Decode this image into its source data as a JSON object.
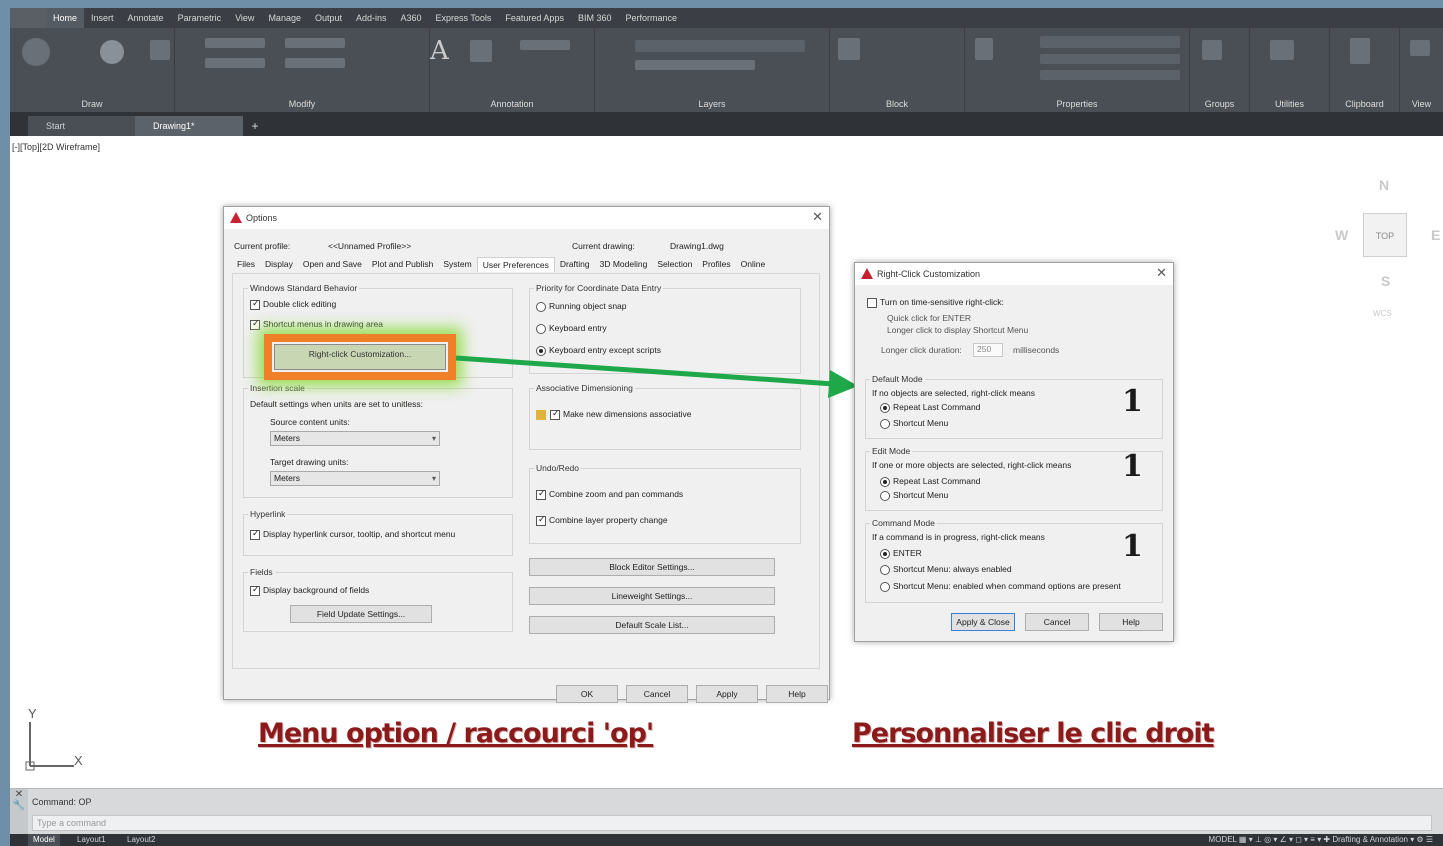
{
  "ribbon": {
    "tabs": [
      "Home",
      "Insert",
      "Annotate",
      "Parametric",
      "View",
      "Manage",
      "Output",
      "Add-ins",
      "A360",
      "Express Tools",
      "Featured Apps",
      "BIM 360",
      "Performance"
    ],
    "panels": [
      "Draw",
      "Modify",
      "Annotation",
      "Layers",
      "Block",
      "Properties",
      "Groups",
      "Utilities",
      "Clipboard",
      "View"
    ]
  },
  "file_tabs": {
    "start": "Start",
    "drawing": "Drawing1*",
    "plus": "+"
  },
  "viewport_label": "[-][Top][2D Wireframe]",
  "viewcube": {
    "top": "TOP",
    "n": "N",
    "w": "W",
    "e": "E",
    "s": "S",
    "wcs": "WCS"
  },
  "options_dialog": {
    "title": "Options",
    "current_profile_label": "Current profile:",
    "current_profile_value": "<<Unnamed Profile>>",
    "current_drawing_label": "Current drawing:",
    "current_drawing_value": "Drawing1.dwg",
    "tabs": [
      "Files",
      "Display",
      "Open and Save",
      "Plot and Publish",
      "System",
      "User Preferences",
      "Drafting",
      "3D Modeling",
      "Selection",
      "Profiles",
      "Online"
    ],
    "active_tab": "User Preferences",
    "windows_behavior": {
      "title": "Windows Standard Behavior",
      "double_click": "Double click editing",
      "shortcut_menus": "Shortcut menus in drawing area",
      "right_click_button": "Right-click Customization..."
    },
    "insertion_scale": {
      "title": "Insertion scale",
      "desc": "Default settings when units are set to unitless:",
      "source_label": "Source content units:",
      "source_value": "Meters",
      "target_label": "Target drawing units:",
      "target_value": "Meters"
    },
    "hyperlink": {
      "title": "Hyperlink",
      "option": "Display hyperlink cursor, tooltip, and shortcut menu"
    },
    "fields": {
      "title": "Fields",
      "option": "Display background of fields",
      "button": "Field Update Settings..."
    },
    "priority": {
      "title": "Priority for Coordinate Data Entry",
      "opt1": "Running object snap",
      "opt2": "Keyboard entry",
      "opt3": "Keyboard entry except scripts"
    },
    "assoc": {
      "title": "Associative Dimensioning",
      "option": "Make new dimensions associative"
    },
    "undo": {
      "title": "Undo/Redo",
      "opt1": "Combine zoom and pan commands",
      "opt2": "Combine layer property change"
    },
    "buttons_right": [
      "Block Editor Settings...",
      "Lineweight Settings...",
      "Default Scale List..."
    ],
    "footer": {
      "ok": "OK",
      "cancel": "Cancel",
      "apply": "Apply",
      "help": "Help"
    }
  },
  "rightclick_dialog": {
    "title": "Right-Click Customization",
    "time_sensitive": "Turn on time-sensitive right-click:",
    "quick_click": "Quick click for ENTER",
    "longer_click": "Longer click to display Shortcut Menu",
    "duration_label": "Longer click duration:",
    "duration_value": "250",
    "duration_unit": "milliseconds",
    "default_mode": {
      "title": "Default Mode",
      "desc": "If no objects are selected, right-click means",
      "opt1": "Repeat Last Command",
      "opt2": "Shortcut Menu"
    },
    "edit_mode": {
      "title": "Edit Mode",
      "desc": "If one or more objects are selected, right-click means",
      "opt1": "Repeat Last Command",
      "opt2": "Shortcut Menu"
    },
    "command_mode": {
      "title": "Command Mode",
      "desc": "If a command is in progress, right-click means",
      "opt1": "ENTER",
      "opt2": "Shortcut Menu: always enabled",
      "opt3": "Shortcut Menu: enabled when command options are present"
    },
    "buttons": {
      "apply": "Apply & Close",
      "cancel": "Cancel",
      "help": "Help"
    },
    "markers": [
      "1",
      "1",
      "1"
    ]
  },
  "captions": {
    "left": "Menu option / raccourci 'op'",
    "right": "Personnaliser le clic droit"
  },
  "ucs": {
    "y": "Y",
    "x": "X"
  },
  "command_line": {
    "history": "Command:  OP",
    "placeholder": "Type a command"
  },
  "status_bar": {
    "tabs": [
      "Model",
      "Layout1",
      "Layout2"
    ],
    "right": "MODEL",
    "annotation": "Drafting & Annotation"
  },
  "colors": {
    "highlight": "#f07f2a",
    "arrow": "#1fa84a",
    "caption": "#8b1a1a",
    "ribbon": "#4a4f56"
  }
}
